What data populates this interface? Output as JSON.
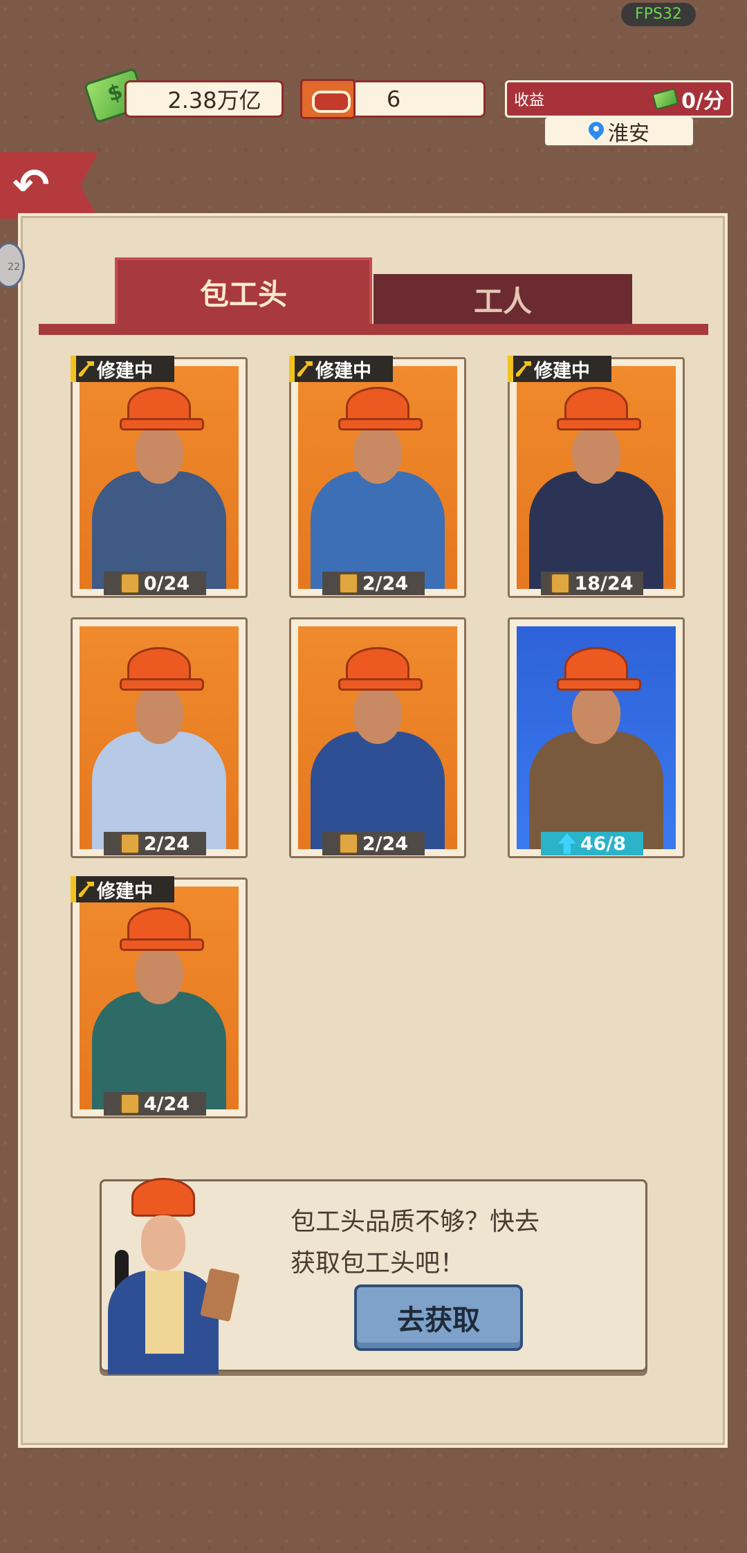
{
  "status": {
    "fps": "FPS32"
  },
  "header": {
    "money": "2.38万亿",
    "tickets": "6",
    "income_label": "收益",
    "income_value": "0/分",
    "location": "淮安"
  },
  "tabs": [
    {
      "label": "包工头",
      "active": true
    },
    {
      "label": "工人",
      "active": false
    }
  ],
  "side_bubble": "22",
  "foremen": [
    {
      "status": "修建中",
      "count": "0/24",
      "theme": "orange",
      "body_color": "#3f5a84",
      "upgrade": false
    },
    {
      "status": "修建中",
      "count": "2/24",
      "theme": "orange",
      "body_color": "#3d6fb6",
      "upgrade": false
    },
    {
      "status": "修建中",
      "count": "18/24",
      "theme": "orange",
      "body_color": "#2b3454",
      "upgrade": false
    },
    {
      "status": "",
      "count": "2/24",
      "theme": "orange",
      "body_color": "#b6c9e6",
      "upgrade": false
    },
    {
      "status": "",
      "count": "2/24",
      "theme": "orange",
      "body_color": "#2f4f95",
      "upgrade": false
    },
    {
      "status": "",
      "count": "46/8",
      "theme": "blue",
      "body_color": "#7a5a3e",
      "upgrade": true
    },
    {
      "status": "修建中",
      "count": "4/24",
      "theme": "orange",
      "body_color": "#2e6a66",
      "upgrade": false
    }
  ],
  "promo": {
    "line1": "包工头品质不够？快去",
    "line2": "获取包工头吧！",
    "button": "去获取"
  },
  "colors": {
    "accent_red": "#a8393c",
    "panel_bg": "#e9dcc3",
    "card_orange": "#f08a2c"
  }
}
